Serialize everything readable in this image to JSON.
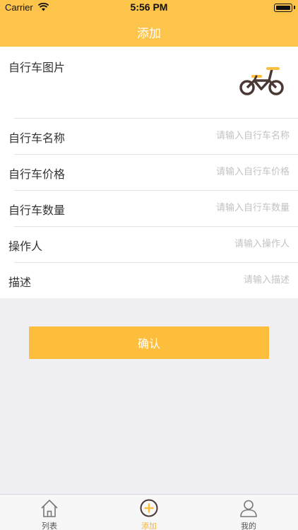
{
  "status_bar": {
    "carrier": "Carrier",
    "time": "5:56 PM"
  },
  "nav": {
    "title": "添加"
  },
  "form": {
    "photo_label": "自行车图片",
    "bike_icon": "bicycle-icon",
    "rows": [
      {
        "label": "自行车名称",
        "placeholder": "请输入自行车名称",
        "value": ""
      },
      {
        "label": "自行车价格",
        "placeholder": "请输入自行车价格",
        "value": ""
      },
      {
        "label": "自行车数量",
        "placeholder": "请输入自行车数量",
        "value": ""
      },
      {
        "label": "操作人",
        "placeholder": "请输入操作人",
        "value": ""
      },
      {
        "label": "描述",
        "placeholder": "请输入描述",
        "value": ""
      }
    ]
  },
  "confirm_label": "确认",
  "tabbar": {
    "tabs": [
      {
        "label": "列表",
        "icon": "home-icon",
        "active": false
      },
      {
        "label": "添加",
        "icon": "add-circle-icon",
        "active": true
      },
      {
        "label": "我的",
        "icon": "user-icon",
        "active": false
      }
    ]
  },
  "colors": {
    "accent": "#fdc44c",
    "button": "#fdbe3d",
    "active_tab": "#f5b33a",
    "bike_frame": "#4a3835",
    "bike_accent": "#fdbe3d"
  }
}
